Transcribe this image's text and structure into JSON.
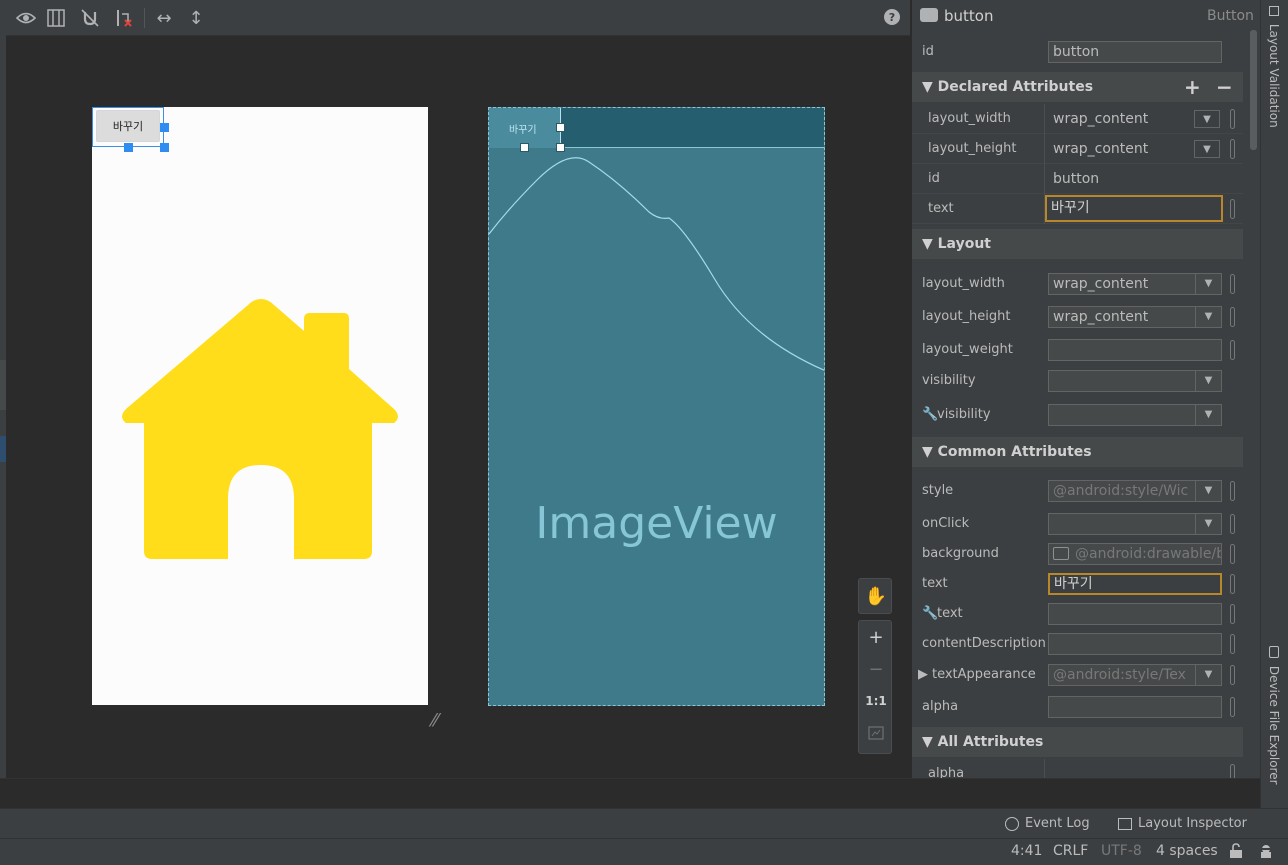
{
  "toolbar": {
    "icons": [
      "eye-icon",
      "blueprint-icon",
      "magnet-off-icon",
      "clear-constraints-icon",
      "horizontal-arrows-icon",
      "vertical-arrows-icon"
    ],
    "help": "?"
  },
  "design": {
    "button_text": "바꾸기",
    "house_color": "#ffdd1a"
  },
  "blueprint": {
    "button_text": "바꾸기",
    "imageview_label": "ImageView"
  },
  "zoom": {
    "pan": "✋",
    "zoom_in": "+",
    "zoom_out": "−",
    "one_to_one": "1:1"
  },
  "attributes": {
    "component_name": "button",
    "component_type": "Button",
    "id_label": "id",
    "id_value": "button",
    "declared": {
      "title": "Declared Attributes",
      "add": "+",
      "remove": "−",
      "rows": [
        {
          "name": "layout_width",
          "value": "wrap_content"
        },
        {
          "name": "layout_height",
          "value": "wrap_content"
        },
        {
          "name": "id",
          "value": "button"
        },
        {
          "name": "text",
          "value": "바꾸기"
        }
      ]
    },
    "layout": {
      "title": "Layout",
      "layout_width_label": "layout_width",
      "layout_width_value": "wrap_content",
      "layout_height_label": "layout_height",
      "layout_height_value": "wrap_content",
      "layout_weight_label": "layout_weight",
      "visibility_label": "visibility",
      "tools_visibility_label": "visibility"
    },
    "common": {
      "title": "Common Attributes",
      "style_label": "style",
      "style_value": "@android:style/Wic",
      "onclick_label": "onClick",
      "background_label": "background",
      "background_value": "@android:drawable/b",
      "text_label": "text",
      "text_value": "바꾸기",
      "tools_text_label": "text",
      "content_desc_label": "contentDescription",
      "text_appearance_label": "textAppearance",
      "text_appearance_value": "@android:style/Tex",
      "alpha_label": "alpha"
    },
    "all": {
      "title": "All Attributes",
      "first_row": "alpha"
    }
  },
  "right_strip": {
    "layout_validation": "Layout Validation",
    "device_file_explorer": "Device File Explorer"
  },
  "tool_windows": {
    "event_log": "Event Log",
    "layout_inspector": "Layout Inspector"
  },
  "status": {
    "position": "4:41",
    "line_sep": "CRLF",
    "encoding": "UTF-8",
    "indent": "4 spaces"
  }
}
